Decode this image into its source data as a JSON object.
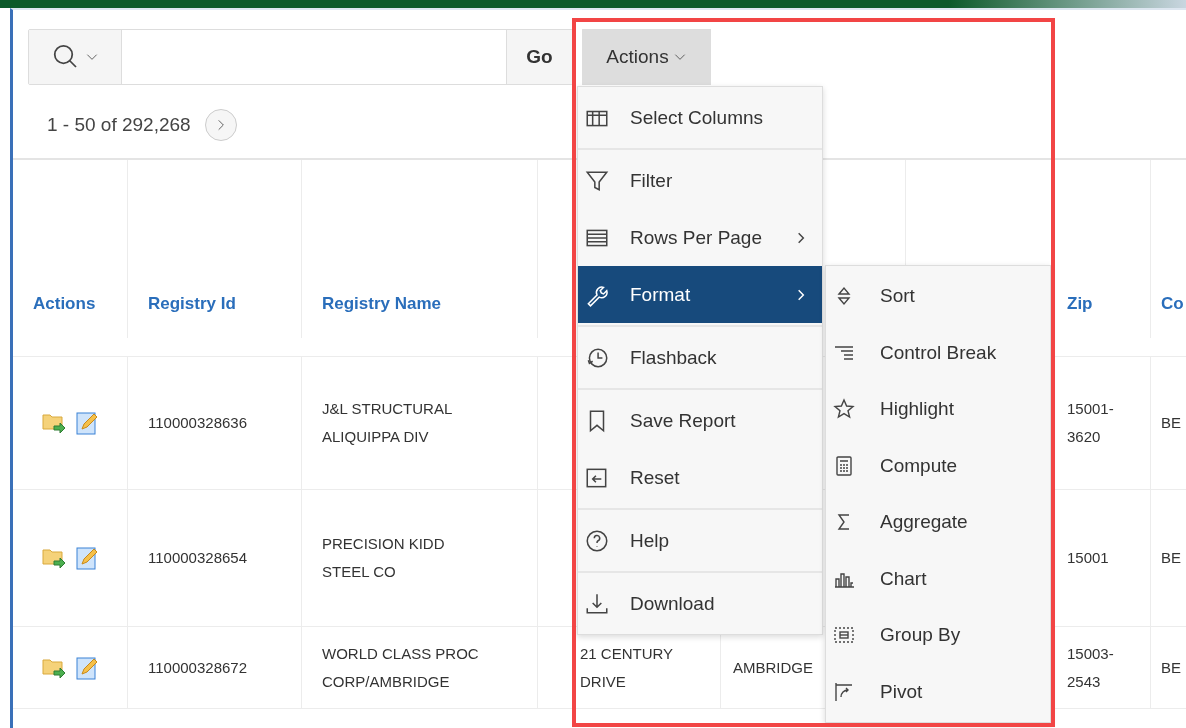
{
  "toolbar": {
    "go_button": "Go",
    "actions_button": "Actions"
  },
  "pagination": {
    "range": "1 - 50 of 292,268"
  },
  "table": {
    "columns": [
      "Actions",
      "Registry Id",
      "Registry Name",
      null,
      null,
      null,
      "Zip",
      "Co"
    ],
    "rows": [
      {
        "cells": [
          null,
          "110000328636",
          "J&L STRUCTURAL ALIQUIPPA DIV",
          null,
          null,
          null,
          "15001-3620",
          "BE"
        ]
      },
      {
        "cells": [
          null,
          "110000328654",
          "PRECISION KIDD STEEL CO",
          null,
          null,
          null,
          "15001",
          "BE"
        ]
      },
      {
        "cells": [
          null,
          "110000328672",
          "WORLD CLASS PROC CORP/AMBRIDGE",
          "21 CENTURY DRIVE",
          "AMBRIDGE",
          null,
          "15003-2543",
          "BE"
        ]
      }
    ]
  },
  "actions_menu": {
    "groups": [
      {
        "items": [
          {
            "label": "Select Columns",
            "kind": "item",
            "selected": false
          }
        ]
      },
      {
        "items": [
          {
            "label": "Filter",
            "kind": "item",
            "selected": false
          },
          {
            "label": "Rows Per Page",
            "kind": "submenu",
            "selected": false
          },
          {
            "label": "Format",
            "kind": "submenu",
            "selected": true
          }
        ]
      },
      {
        "items": [
          {
            "label": "Flashback",
            "kind": "item",
            "selected": false
          }
        ]
      },
      {
        "items": [
          {
            "label": "Save Report",
            "kind": "item",
            "selected": false
          },
          {
            "label": "Reset",
            "kind": "item",
            "selected": false
          }
        ]
      },
      {
        "items": [
          {
            "label": "Help",
            "kind": "item",
            "selected": false
          }
        ]
      },
      {
        "items": [
          {
            "label": "Download",
            "kind": "item",
            "selected": false
          }
        ]
      }
    ],
    "submenu": {
      "items": [
        "Sort",
        "Control Break",
        "Highlight",
        "Compute",
        "Aggregate",
        "Chart",
        "Group By",
        "Pivot"
      ]
    }
  }
}
